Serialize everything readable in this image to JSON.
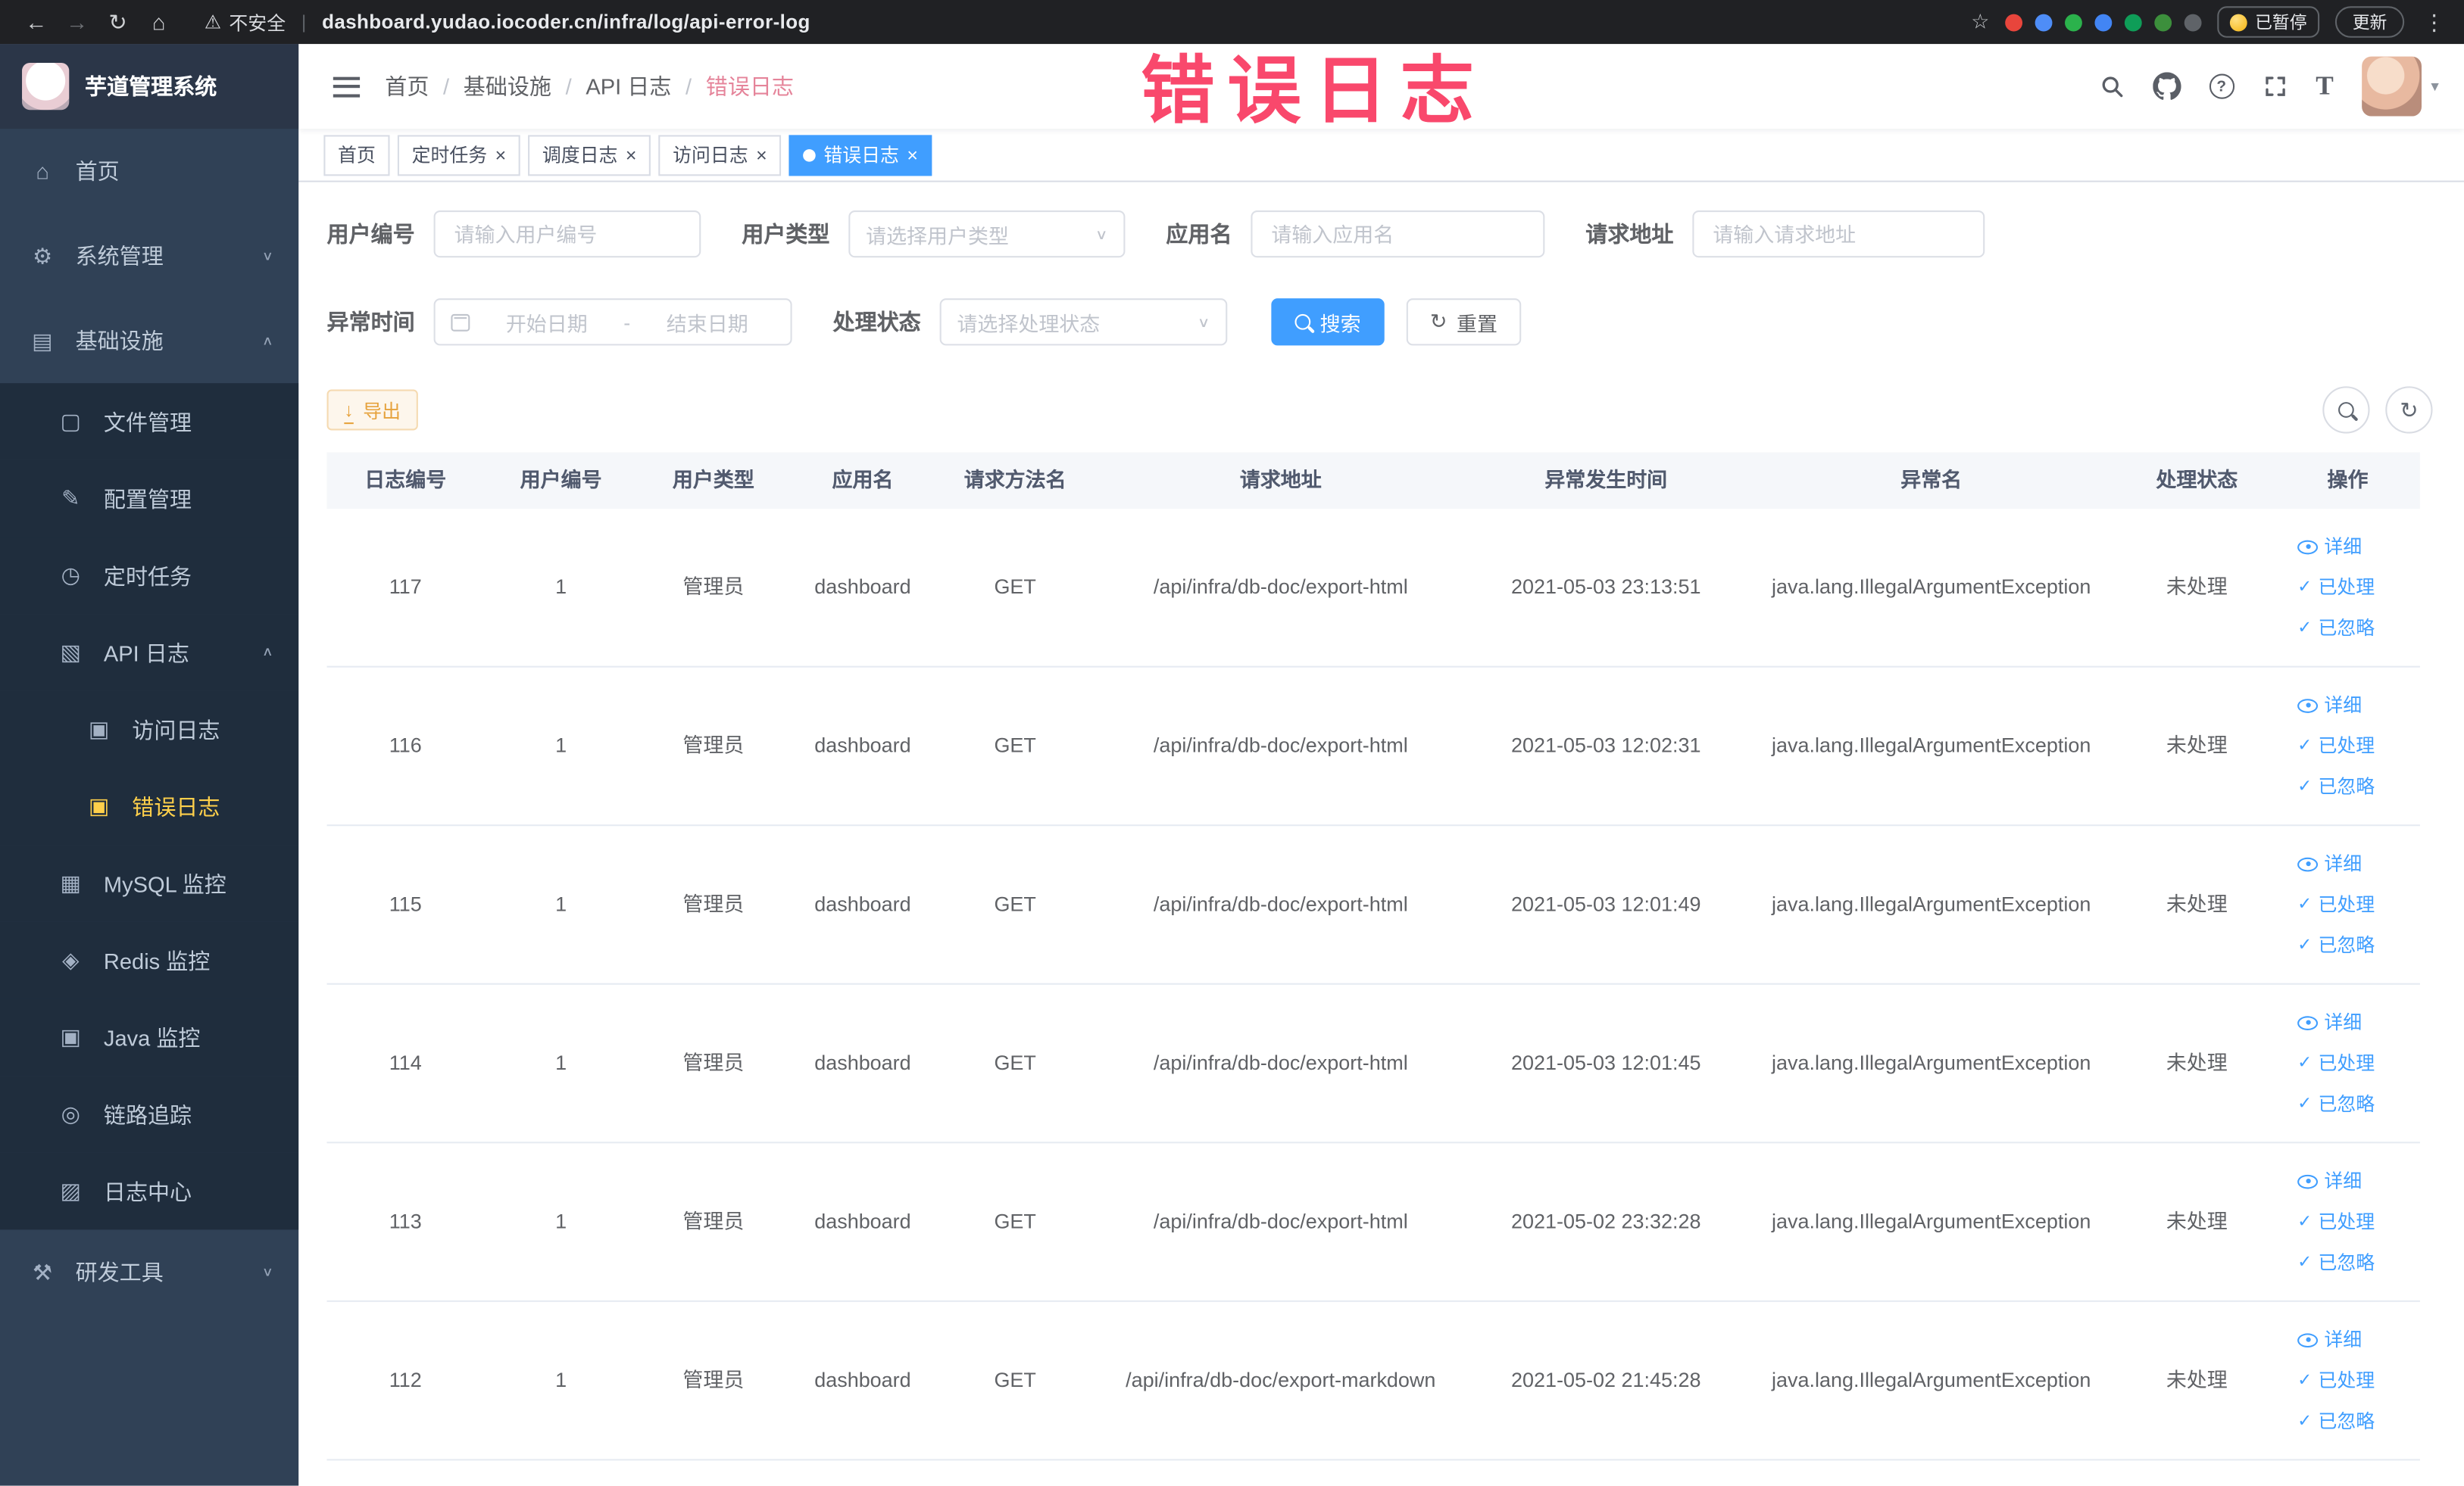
{
  "icons": {
    "back": "←",
    "forward": "→",
    "reload": "↻",
    "home": "⌂",
    "star": "☆",
    "warning": "⚠",
    "divider": "|",
    "more": "⋮",
    "caret_down": "▾",
    "chevron_down": "∨",
    "chevron_up": "∧",
    "check": "✓",
    "download": "↓",
    "refresh": "↻",
    "help": "?",
    "font_size": "T",
    "gear": "⚙",
    "monitor": "▤",
    "folder": "▢",
    "config": "✎",
    "timer": "◷",
    "api-log": "▧",
    "access-log": "▣",
    "error-log": "▣",
    "mysql": "▦",
    "redis": "◈",
    "java": "▣",
    "trace": "◎",
    "log-center": "▨",
    "tools": "⚒"
  },
  "browser": {
    "security_label": "不安全",
    "url": "dashboard.yudao.iocoder.cn/infra/log/api-error-log",
    "paused_badge": "已暂停",
    "update_button": "更新",
    "extension_colors": [
      "#e8453c",
      "#4e8df7",
      "#2bb24c",
      "#4285f4",
      "#0f9d58",
      "#3c8f3c",
      "#5f6368"
    ]
  },
  "sidebar": {
    "logo_title": "芋道管理系统",
    "menu": [
      {
        "label": "首页",
        "icon": "home",
        "level": 1
      },
      {
        "label": "系统管理",
        "icon": "gear",
        "level": 1,
        "arrow": "down"
      },
      {
        "label": "基础设施",
        "icon": "monitor",
        "level": 1,
        "arrow": "up"
      },
      {
        "label": "文件管理",
        "icon": "folder",
        "level": 2
      },
      {
        "label": "配置管理",
        "icon": "config",
        "level": 2
      },
      {
        "label": "定时任务",
        "icon": "timer",
        "level": 2
      },
      {
        "label": "API 日志",
        "icon": "api-log",
        "level": 2,
        "arrow": "up"
      },
      {
        "label": "访问日志",
        "icon": "access-log",
        "level": 3
      },
      {
        "label": "错误日志",
        "icon": "error-log",
        "level": 3,
        "active": true
      },
      {
        "label": "MySQL 监控",
        "icon": "mysql",
        "level": 2
      },
      {
        "label": "Redis 监控",
        "icon": "redis",
        "level": 2
      },
      {
        "label": "Java 监控",
        "icon": "java",
        "level": 2
      },
      {
        "label": "链路追踪",
        "icon": "trace",
        "level": 2
      },
      {
        "label": "日志中心",
        "icon": "log-center",
        "level": 2
      },
      {
        "label": "研发工具",
        "icon": "tools",
        "level": 1,
        "arrow": "down"
      }
    ]
  },
  "header": {
    "breadcrumb": [
      "首页",
      "基础设施",
      "API 日志",
      "错误日志"
    ],
    "watermark": "错误日志"
  },
  "tabs": [
    {
      "label": "首页",
      "closable": false,
      "active": false
    },
    {
      "label": "定时任务",
      "closable": true,
      "active": false
    },
    {
      "label": "调度日志",
      "closable": true,
      "active": false
    },
    {
      "label": "访问日志",
      "closable": true,
      "active": false
    },
    {
      "label": "错误日志",
      "closable": true,
      "active": true
    }
  ],
  "filters": {
    "user_id": {
      "label": "用户编号",
      "placeholder": "请输入用户编号"
    },
    "user_type": {
      "label": "用户类型",
      "placeholder": "请选择用户类型"
    },
    "app_name": {
      "label": "应用名",
      "placeholder": "请输入应用名"
    },
    "request_url": {
      "label": "请求地址",
      "placeholder": "请输入请求地址"
    },
    "exception_time": {
      "label": "异常时间",
      "start_placeholder": "开始日期",
      "separator": "-",
      "end_placeholder": "结束日期"
    },
    "process_status": {
      "label": "处理状态",
      "placeholder": "请选择处理状态"
    },
    "search_button": "搜索",
    "reset_button": "重置"
  },
  "toolbar": {
    "export_button": "导出"
  },
  "table": {
    "columns": [
      "日志编号",
      "用户编号",
      "用户类型",
      "应用名",
      "请求方法名",
      "请求地址",
      "异常发生时间",
      "异常名",
      "处理状态",
      "操作"
    ],
    "actions": [
      "详细",
      "已处理",
      "已忽略"
    ],
    "rows": [
      {
        "id": "117",
        "user_id": "1",
        "user_type": "管理员",
        "app": "dashboard",
        "method": "GET",
        "url": "/api/infra/db-doc/export-html",
        "time": "2021-05-03 23:13:51",
        "exception": "java.lang.IllegalArgumentException",
        "status": "未处理"
      },
      {
        "id": "116",
        "user_id": "1",
        "user_type": "管理员",
        "app": "dashboard",
        "method": "GET",
        "url": "/api/infra/db-doc/export-html",
        "time": "2021-05-03 12:02:31",
        "exception": "java.lang.IllegalArgumentException",
        "status": "未处理"
      },
      {
        "id": "115",
        "user_id": "1",
        "user_type": "管理员",
        "app": "dashboard",
        "method": "GET",
        "url": "/api/infra/db-doc/export-html",
        "time": "2021-05-03 12:01:49",
        "exception": "java.lang.IllegalArgumentException",
        "status": "未处理"
      },
      {
        "id": "114",
        "user_id": "1",
        "user_type": "管理员",
        "app": "dashboard",
        "method": "GET",
        "url": "/api/infra/db-doc/export-html",
        "time": "2021-05-03 12:01:45",
        "exception": "java.lang.IllegalArgumentException",
        "status": "未处理"
      },
      {
        "id": "113",
        "user_id": "1",
        "user_type": "管理员",
        "app": "dashboard",
        "method": "GET",
        "url": "/api/infra/db-doc/export-html",
        "time": "2021-05-02 23:32:28",
        "exception": "java.lang.IllegalArgumentException",
        "status": "未处理"
      },
      {
        "id": "112",
        "user_id": "1",
        "user_type": "管理员",
        "app": "dashboard",
        "method": "GET",
        "url": "/api/infra/db-doc/export-markdown",
        "time": "2021-05-02 21:45:28",
        "exception": "java.lang.IllegalArgumentException",
        "status": "未处理"
      }
    ]
  },
  "colors": {
    "primary": "#409eff",
    "sidebar_bg": "#304156",
    "sidebar_sub_bg": "#1f2d3d",
    "active_menu_text": "#ffd04b",
    "watermark": "#f9486c",
    "warning": "#e6a23c",
    "active_tab_bg": "#409eff",
    "chrome_bg": "#202124"
  }
}
